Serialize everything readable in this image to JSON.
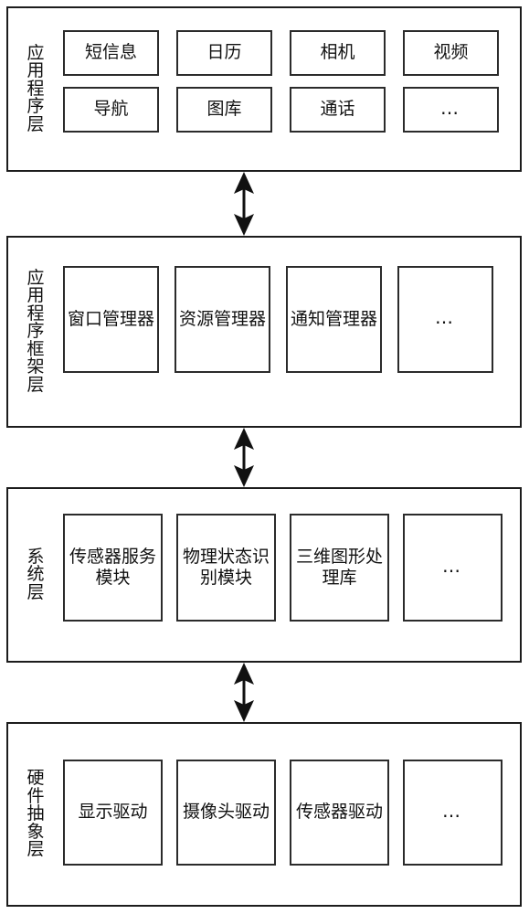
{
  "diagram": {
    "title": "Android layered system architecture",
    "background_color": "#ffffff",
    "line_color": "#1c1c1c"
  },
  "layers": [
    {
      "id": "application-layer",
      "label": "应用程序层",
      "label_chars": [
        "应",
        "用",
        "程",
        "序",
        "层"
      ],
      "rows": [
        {
          "modules": [
            {
              "label": "短信息"
            },
            {
              "label": "日历"
            },
            {
              "label": "相机"
            },
            {
              "label": "视频"
            }
          ]
        },
        {
          "modules": [
            {
              "label": "导航"
            },
            {
              "label": "图库"
            },
            {
              "label": "通话"
            },
            {
              "label": "…"
            }
          ]
        }
      ]
    },
    {
      "id": "application-framework-layer",
      "label": "应用程序框架层",
      "label_chars": [
        "应",
        "用",
        "程",
        "序",
        "框",
        "架",
        "层"
      ],
      "rows": [
        {
          "modules": [
            {
              "label": "窗口管理器"
            },
            {
              "label": "资源管理器"
            },
            {
              "label": "通知管理器"
            },
            {
              "label": "…"
            }
          ]
        }
      ]
    },
    {
      "id": "system-layer",
      "label": "系统层",
      "label_chars": [
        "系",
        "统",
        "层"
      ],
      "rows": [
        {
          "modules": [
            {
              "label": "传感器服务模块"
            },
            {
              "label": "物理状态识别模块"
            },
            {
              "label": "三维图形处理库"
            },
            {
              "label": "…"
            }
          ]
        }
      ]
    },
    {
      "id": "hardware-abstraction-layer",
      "label": "硬件抽象层",
      "label_chars": [
        "硬",
        "件",
        "抽",
        "象",
        "层"
      ],
      "rows": [
        {
          "modules": [
            {
              "label": "显示驱动"
            },
            {
              "label": "摄像头驱动"
            },
            {
              "label": "传感器驱动"
            },
            {
              "label": "…"
            }
          ]
        }
      ]
    }
  ],
  "connectors": [
    {
      "id": "connector-app-framework",
      "type": "double-arrow-vertical"
    },
    {
      "id": "connector-framework-system",
      "type": "double-arrow-vertical"
    },
    {
      "id": "connector-system-hal",
      "type": "double-arrow-vertical"
    }
  ]
}
